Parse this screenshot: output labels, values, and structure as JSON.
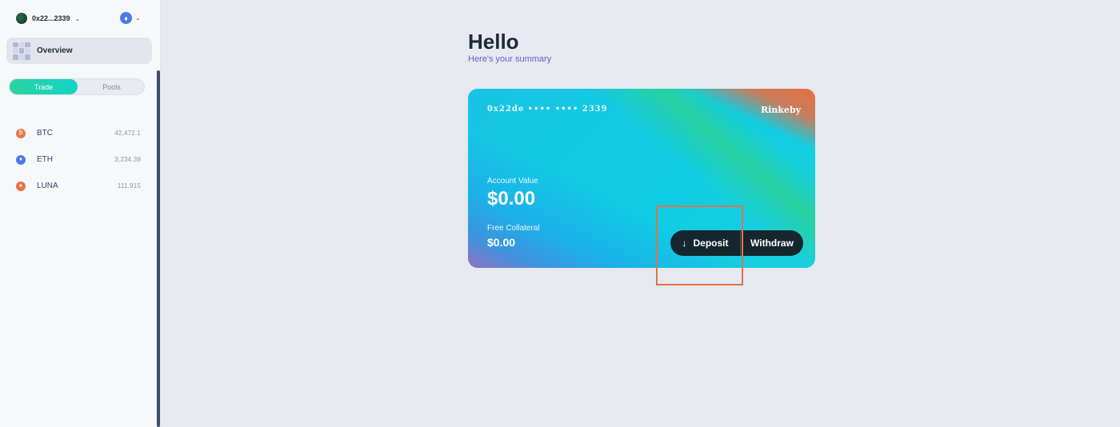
{
  "sidebar": {
    "account": {
      "label": "0x22...2339"
    },
    "network_icon": "ethereum-icon",
    "overview_label": "Overview",
    "tabs": [
      {
        "label": "Trade",
        "active": true
      },
      {
        "label": "Pools",
        "active": false
      }
    ],
    "markets": [
      {
        "symbol": "BTC",
        "price": "42,472.1",
        "color": "#e8734b",
        "icon": "bitcoin-icon"
      },
      {
        "symbol": "ETH",
        "price": "3,234.39",
        "color": "#4b7be5",
        "icon": "ethereum-icon"
      },
      {
        "symbol": "LUNA",
        "price": "111.915",
        "color": "#e8734b",
        "icon": "luna-icon"
      }
    ]
  },
  "main": {
    "greeting": "Hello",
    "subtitle": "Here's your summary",
    "card": {
      "number": "0x22de •••• •••• 2339",
      "network": "Rinkeby",
      "account_value_label": "Account Value",
      "account_value": "$0.00",
      "collateral_label": "Free Collateral",
      "collateral_value": "$0.00",
      "deposit_label": "Deposit",
      "withdraw_label": "Withdraw"
    }
  },
  "colors": {
    "accent": "#2ad3a1",
    "highlight": "#e0744c",
    "button_bg": "#16262e"
  }
}
